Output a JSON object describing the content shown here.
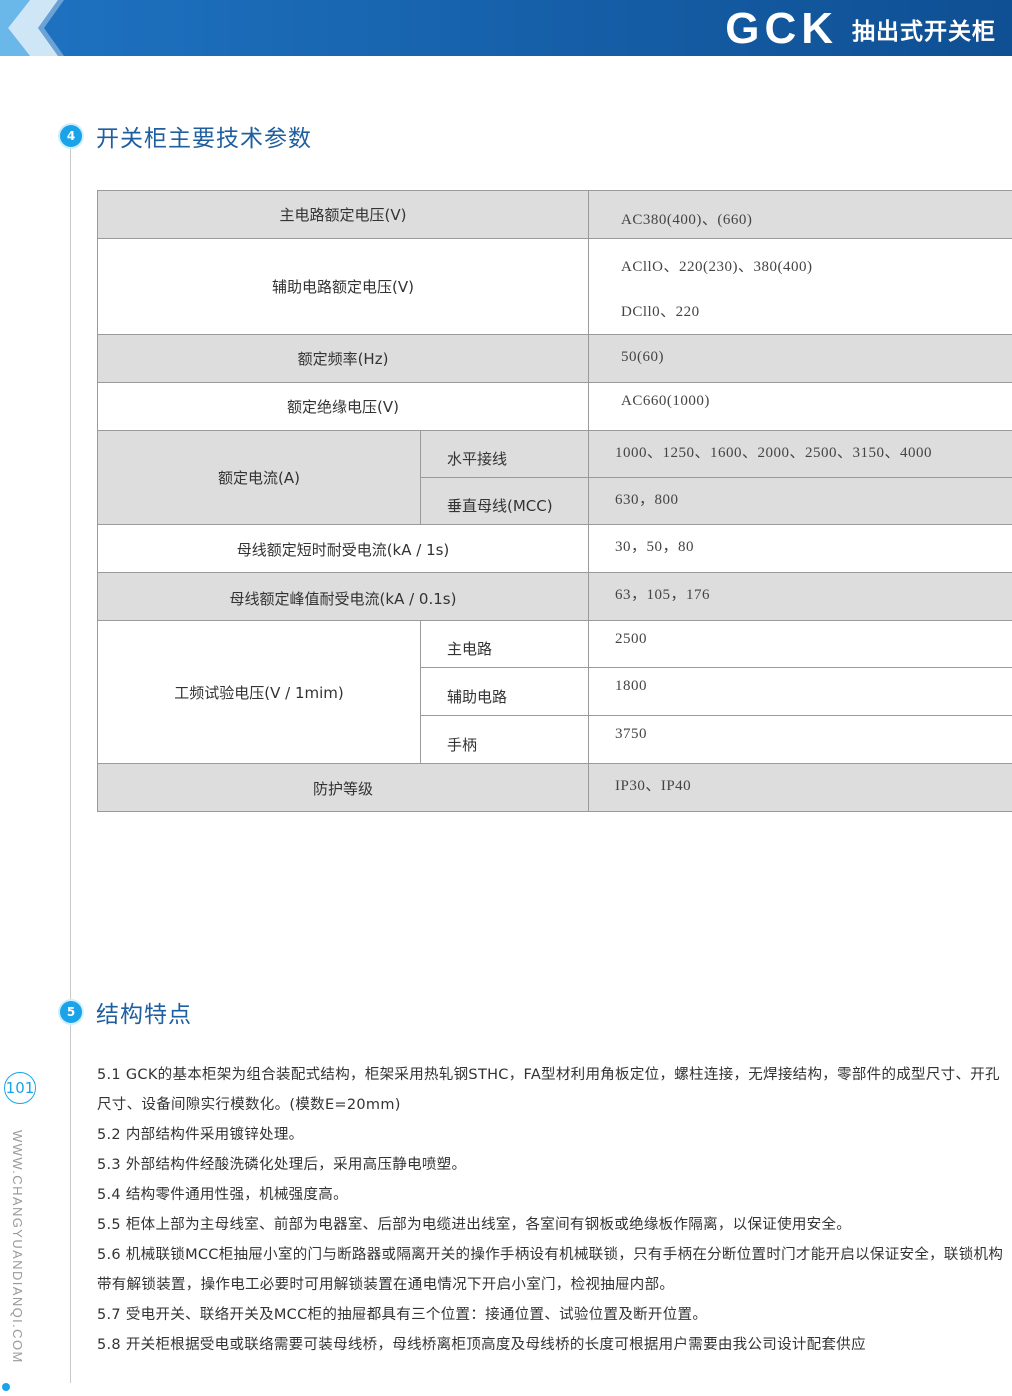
{
  "header": {
    "brand": "GCK",
    "subtitle": "抽出式开关柜",
    "colors": {
      "banner": "#1761ad",
      "banner_dark": "#0f4f93",
      "accent": "#1aa3e8"
    }
  },
  "side": {
    "page_number": "101",
    "website": "WWW.CHANGYUANDIANQI.COM"
  },
  "section4": {
    "number": "4",
    "title": "开关柜主要技术参数"
  },
  "spec_table": {
    "main_voltage": {
      "label": "主电路额定电压(V)",
      "value": "AC380(400)、(660)"
    },
    "aux_voltage": {
      "label": "辅助电路额定电压(V)",
      "value_ac": "ACllO、220(230)、380(400)",
      "value_dc": "DCll0、220"
    },
    "frequency": {
      "label": "额定频率(Hz)",
      "value": "50(60)"
    },
    "insulation": {
      "label": "额定绝缘电压(V)",
      "value": "AC660(1000)"
    },
    "current": {
      "label": "额定电流(A)",
      "horizontal_label": "水平接线",
      "horizontal_value": "1000、1250、1600、2000、2500、3150、4000",
      "vertical_label": "垂直母线(MCC)",
      "vertical_value": "630，800"
    },
    "short_time": {
      "label": "母线额定短时耐受电流(kA / 1s)",
      "value": "30，50，80"
    },
    "peak": {
      "label": "母线额定峰值耐受电流(kA / 0.1s)",
      "value": "63，105，176"
    },
    "power_freq": {
      "label": "工频试验电压(V / 1mim)",
      "main_label": "主电路",
      "main_value": "2500",
      "aux_label": "辅助电路",
      "aux_value": "1800",
      "handle_label": "手柄",
      "handle_value": "3750"
    },
    "protection": {
      "label": "防护等级",
      "value": "IP30、IP40"
    }
  },
  "section5": {
    "number": "5",
    "title": "结构特点",
    "items": [
      "5.1 GCK的基本柜架为组合装配式结构，柜架采用热轧钢STHC，FA型材利用角板定位，螺柱连接，无焊接结构，零部件的成型尺寸、开孔尺寸、设备间隙实行模数化。(模数E=20mm)",
      "5.2 内部结构件采用镀锌处理。",
      "5.3 外部结构件经酸洗磷化处理后，采用高压静电喷塑。",
      "5.4 结构零件通用性强，机械强度高。",
      "5.5 柜体上部为主母线室、前部为电器室、后部为电缆进出线室，各室间有钢板或绝缘板作隔离，以保证使用安全。",
      "5.6 机械联锁MCC柜抽屉小室的门与断路器或隔离开关的操作手柄设有机械联锁，只有手柄在分断位置时门才能开启以保证安全，联锁机构带有解锁装置，操作电工必要时可用解锁装置在通电情况下开启小室门，检视抽屉内部。",
      "5.7 受电开关、联络开关及MCC柜的抽屉都具有三个位置：接通位置、试验位置及断开位置。",
      "5.8 开关柜根据受电或联络需要可装母线桥，母线桥离柜顶高度及母线桥的长度可根据用户需要由我公司设计配套供应"
    ]
  }
}
